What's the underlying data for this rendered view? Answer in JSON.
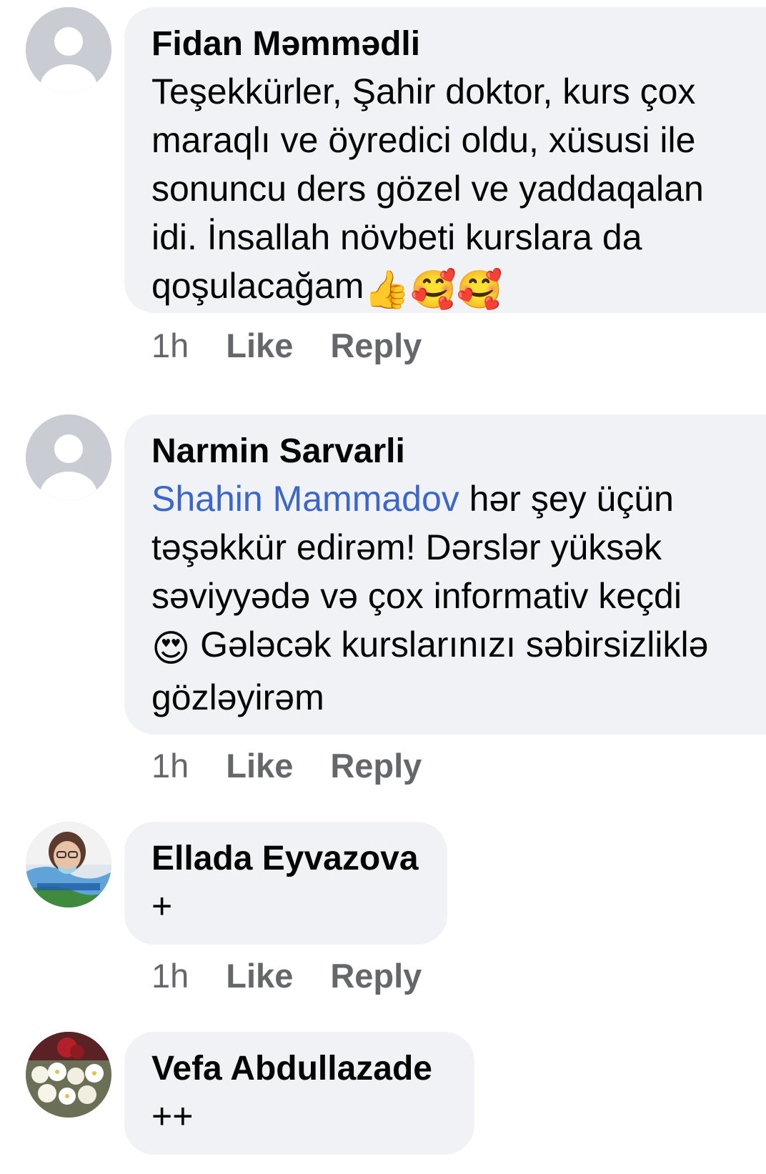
{
  "comments": [
    {
      "author": "Fidan Məmmədli",
      "lines": [
        "Teşekkürler, Şahir doktor, kurs çox",
        "maraqlı ve öyredici oldu, xüsusi ile",
        "sonuncu ders gözel ve yaddaqalan",
        "idi. İnsallah növbeti kurslara da",
        "qoşulacağam"
      ],
      "emojis": "👍🥰🥰",
      "time": "1h",
      "like": "Like",
      "reply": "Reply"
    },
    {
      "author": "Narmin Sarvarli",
      "mention": "Shahin Mammadov",
      "line1_rest": " hər şey üçün",
      "line2": "təşəkkür edirəm! Dərslər yüksək",
      "line3": "səviyyədə və çox informativ keçdi",
      "emoji": "😍",
      "line4": " Gələcək kurslarınızı səbirsizliklə",
      "line5": "gözləyirəm",
      "time": "1h",
      "like": "Like",
      "reply": "Reply"
    },
    {
      "author": "Ellada Eyvazova",
      "text": "+",
      "time": "1h",
      "like": "Like",
      "reply": "Reply"
    },
    {
      "author": "Vefa Abdullazade",
      "text": "++"
    }
  ],
  "colors": {
    "bubble": "#f0f2f5",
    "mention": "#3b66cc",
    "meta": "#65676b"
  }
}
